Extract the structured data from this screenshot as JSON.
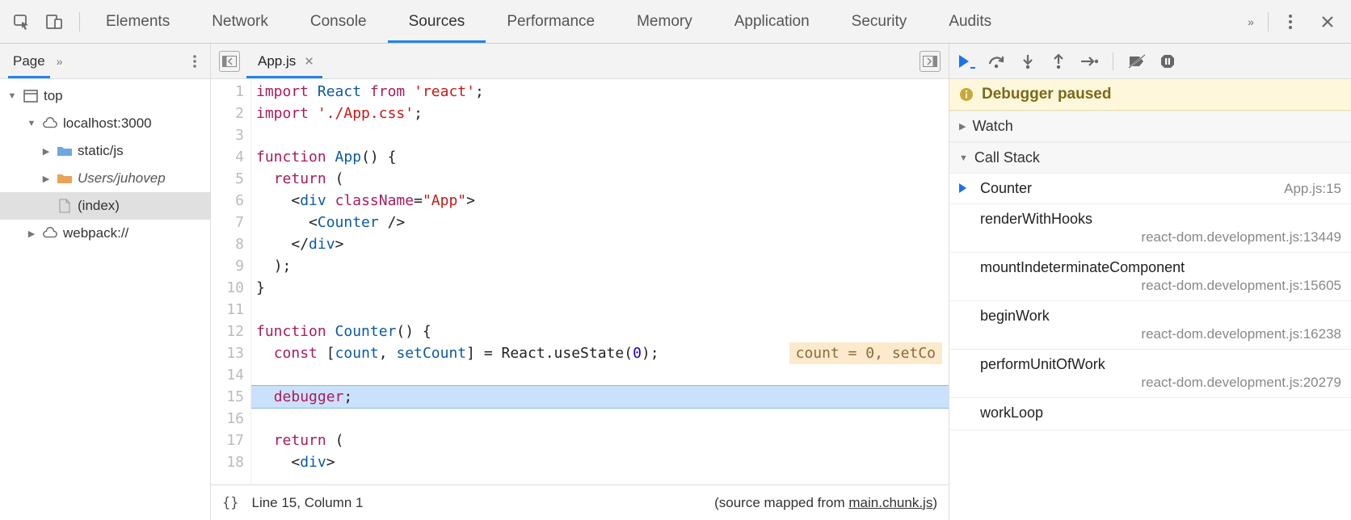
{
  "topbar": {
    "tabs": [
      "Elements",
      "Network",
      "Console",
      "Sources",
      "Performance",
      "Memory",
      "Application",
      "Security",
      "Audits"
    ],
    "active_tab": "Sources"
  },
  "navigator": {
    "tab_label": "Page",
    "more": "»",
    "tree": [
      {
        "id": "top",
        "label": "top",
        "depth": 0,
        "expanded": true,
        "icon": "window"
      },
      {
        "id": "host",
        "label": "localhost:3000",
        "depth": 1,
        "expanded": true,
        "icon": "cloud"
      },
      {
        "id": "static",
        "label": "static/js",
        "depth": 2,
        "expanded": false,
        "icon": "folder-blue"
      },
      {
        "id": "users",
        "label": "Users/juhovep",
        "depth": 2,
        "expanded": false,
        "icon": "folder-orange",
        "italic": true
      },
      {
        "id": "index",
        "label": "(index)",
        "depth": 2,
        "expanded": null,
        "icon": "file",
        "selected": true
      },
      {
        "id": "webpack",
        "label": "webpack://",
        "depth": 1,
        "expanded": false,
        "icon": "cloud"
      }
    ]
  },
  "editor": {
    "tab_name": "App.js",
    "lines": [
      {
        "n": 1,
        "tokens": [
          [
            "kw",
            "import"
          ],
          [
            "pln",
            " "
          ],
          [
            "def",
            "React"
          ],
          [
            "pln",
            " "
          ],
          [
            "kw",
            "from"
          ],
          [
            "pln",
            " "
          ],
          [
            "str",
            "'react'"
          ],
          [
            "op",
            ";"
          ]
        ]
      },
      {
        "n": 2,
        "tokens": [
          [
            "kw",
            "import"
          ],
          [
            "pln",
            " "
          ],
          [
            "str",
            "'./App.css'"
          ],
          [
            "op",
            ";"
          ]
        ]
      },
      {
        "n": 3,
        "tokens": []
      },
      {
        "n": 4,
        "tokens": [
          [
            "kw",
            "function"
          ],
          [
            "pln",
            " "
          ],
          [
            "def",
            "App"
          ],
          [
            "op",
            "() {"
          ]
        ]
      },
      {
        "n": 5,
        "tokens": [
          [
            "pln",
            "  "
          ],
          [
            "kw",
            "return"
          ],
          [
            "pln",
            " "
          ],
          [
            "op",
            "("
          ]
        ]
      },
      {
        "n": 6,
        "tokens": [
          [
            "pln",
            "    "
          ],
          [
            "op",
            "<"
          ],
          [
            "tag",
            "div"
          ],
          [
            "pln",
            " "
          ],
          [
            "attr",
            "className"
          ],
          [
            "op",
            "="
          ],
          [
            "str",
            "\"App\""
          ],
          [
            "op",
            ">"
          ]
        ]
      },
      {
        "n": 7,
        "tokens": [
          [
            "pln",
            "      "
          ],
          [
            "op",
            "<"
          ],
          [
            "tag",
            "Counter"
          ],
          [
            "pln",
            " "
          ],
          [
            "op",
            "/>"
          ]
        ]
      },
      {
        "n": 8,
        "tokens": [
          [
            "pln",
            "    "
          ],
          [
            "op",
            "</"
          ],
          [
            "tag",
            "div"
          ],
          [
            "op",
            ">"
          ]
        ]
      },
      {
        "n": 9,
        "tokens": [
          [
            "pln",
            "  "
          ],
          [
            "op",
            ");"
          ]
        ]
      },
      {
        "n": 10,
        "tokens": [
          [
            "op",
            "}"
          ]
        ]
      },
      {
        "n": 11,
        "tokens": []
      },
      {
        "n": 12,
        "tokens": [
          [
            "kw",
            "function"
          ],
          [
            "pln",
            " "
          ],
          [
            "def",
            "Counter"
          ],
          [
            "op",
            "() {"
          ]
        ]
      },
      {
        "n": 13,
        "tokens": [
          [
            "pln",
            "  "
          ],
          [
            "kw",
            "const"
          ],
          [
            "pln",
            " "
          ],
          [
            "op",
            "["
          ],
          [
            "def",
            "count"
          ],
          [
            "op",
            ", "
          ],
          [
            "def",
            "setCount"
          ],
          [
            "op",
            "] = "
          ],
          [
            "pln",
            "React"
          ],
          [
            "op",
            "."
          ],
          [
            "pln",
            "useState"
          ],
          [
            "op",
            "("
          ],
          [
            "num",
            "0"
          ],
          [
            "op",
            ");"
          ]
        ],
        "inline": "count = 0, setCo"
      },
      {
        "n": 14,
        "tokens": []
      },
      {
        "n": 15,
        "tokens": [
          [
            "pln",
            "  "
          ],
          [
            "kw",
            "debugger"
          ],
          [
            "op",
            ";"
          ]
        ],
        "current": true
      },
      {
        "n": 16,
        "tokens": []
      },
      {
        "n": 17,
        "tokens": [
          [
            "pln",
            "  "
          ],
          [
            "kw",
            "return"
          ],
          [
            "pln",
            " "
          ],
          [
            "op",
            "("
          ]
        ]
      },
      {
        "n": 18,
        "tokens": [
          [
            "pln",
            "    "
          ],
          [
            "op",
            "<"
          ],
          [
            "tag",
            "div"
          ],
          [
            "op",
            ">"
          ]
        ]
      }
    ],
    "status": {
      "format_label": "{}",
      "cursor": "Line 15, Column 1",
      "source_mapped_prefix": "(source mapped from ",
      "source_mapped_link": "main.chunk.js",
      "source_mapped_suffix": ")"
    }
  },
  "debugger": {
    "banner": "Debugger paused",
    "sections": {
      "watch": {
        "label": "Watch",
        "expanded": false
      },
      "call_stack": {
        "label": "Call Stack",
        "expanded": true
      }
    },
    "frames": [
      {
        "fn": "Counter",
        "loc": "App.js:15",
        "active": true
      },
      {
        "fn": "renderWithHooks",
        "loc": "react-dom.development.js:13449"
      },
      {
        "fn": "mountIndeterminateComponent",
        "loc": "react-dom.development.js:15605"
      },
      {
        "fn": "beginWork",
        "loc": "react-dom.development.js:16238"
      },
      {
        "fn": "performUnitOfWork",
        "loc": "react-dom.development.js:20279"
      },
      {
        "fn": "workLoop",
        "loc": ""
      }
    ]
  }
}
